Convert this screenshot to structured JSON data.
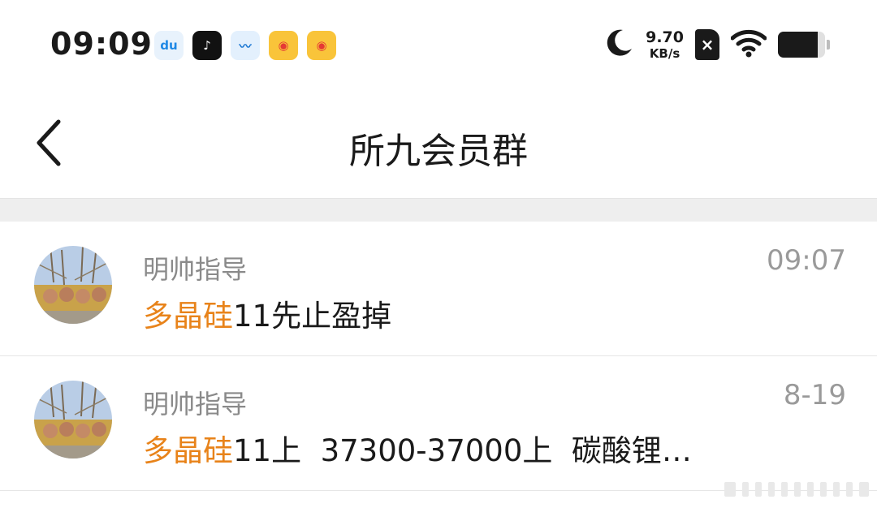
{
  "status_bar": {
    "time": "09:09",
    "app_icons": [
      {
        "name": "du-icon",
        "glyph": "du",
        "color": "#1e88e5"
      },
      {
        "name": "tiktok-icon",
        "glyph": "♪",
        "color": "#111111"
      },
      {
        "name": "stock-chart-icon",
        "glyph": "〰",
        "color": "#1976d2"
      },
      {
        "name": "weibo-icon",
        "glyph": "◉",
        "color": "#f9c43a"
      },
      {
        "name": "weibo-icon",
        "glyph": "◉",
        "color": "#f9c43a"
      }
    ],
    "network_speed_value": "9.70",
    "network_speed_unit": "KB/s",
    "sim_mark": "×",
    "battery_level": 0.85
  },
  "nav": {
    "title": "所九会员群"
  },
  "messages": [
    {
      "sender": "明帅指导",
      "time": "09:07",
      "highlight": "多晶硅",
      "text": "11先止盈掉"
    },
    {
      "sender": "明帅指导",
      "time": "8-19",
      "highlight": "多晶硅",
      "text": "11上  37300-37000上  碳酸锂…"
    }
  ],
  "colors": {
    "highlight": "#e8831a",
    "muted": "#8a8a8a",
    "separator": "#eeeeee"
  }
}
